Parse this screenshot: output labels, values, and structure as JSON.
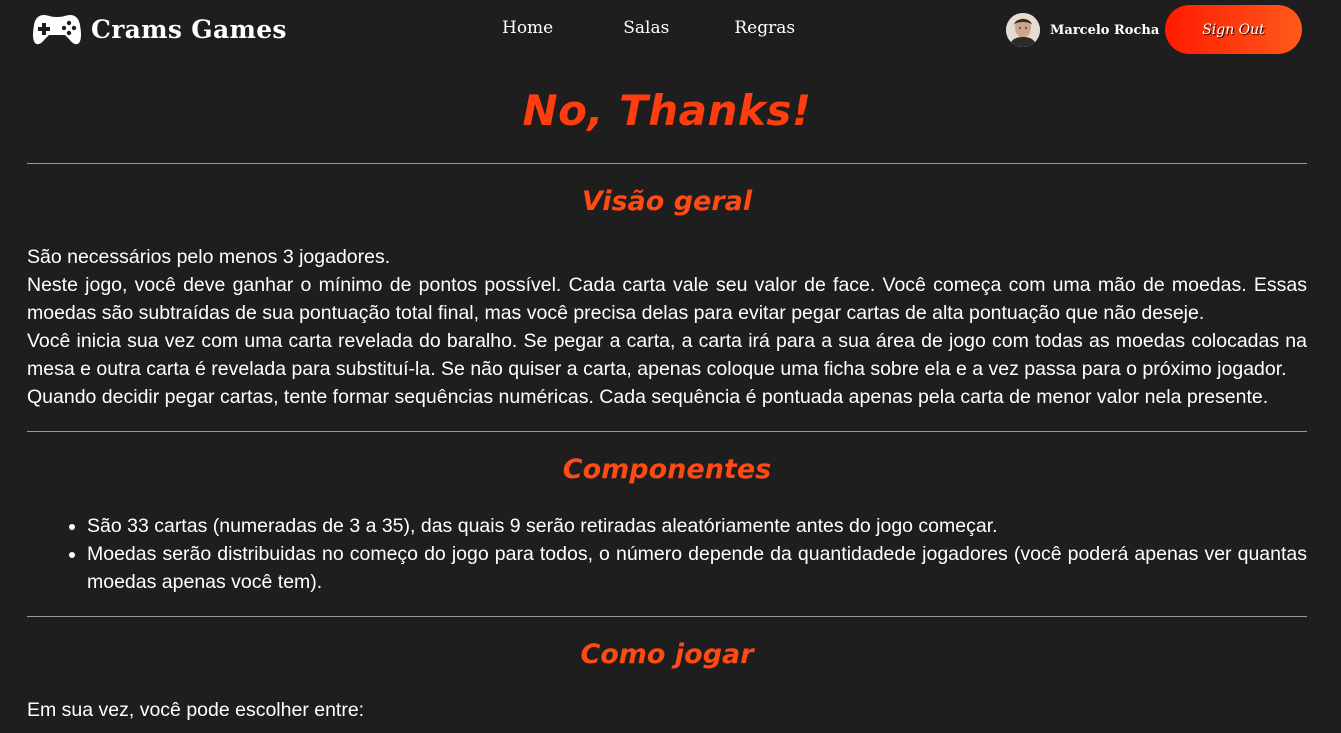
{
  "header": {
    "brand": "Crams Games",
    "brand_icon": "gamepad-icon",
    "nav": [
      "Home",
      "Salas",
      "Regras"
    ],
    "user_name": "Marcelo Rocha",
    "sign_out": "Sign Out"
  },
  "page": {
    "title": "No, Thanks!"
  },
  "sections": {
    "overview": {
      "title": "Visão geral",
      "lines": [
        "São necessários pelo menos 3 jogadores.",
        "Neste jogo, você deve ganhar o mínimo de pontos possível. Cada carta vale seu valor de face. Você começa com uma mão de moedas. Essas moedas são subtraídas de sua pontuação total final, mas você precisa delas para evitar pegar cartas de alta pontuação que não deseje.",
        "Você inicia sua vez com uma carta revelada do baralho. Se pegar a carta, a carta irá para a sua área de jogo com todas as moedas colocadas na mesa e outra carta é revelada para substituí-la. Se não quiser a carta, apenas coloque uma ficha sobre ela e a vez passa para o próximo jogador.",
        "Quando decidir pegar cartas, tente formar sequências numéricas. Cada sequência é pontuada apenas pela carta de menor valor nela presente."
      ]
    },
    "components": {
      "title": "Componentes",
      "items": [
        "São 33 cartas (numeradas de 3 a 35), das quais 9 serão retiradas aleatóriamente antes do jogo começar.",
        "Moedas serão distribuidas no começo do jogo para todos, o número depende da quantidadede jogadores (você poderá apenas ver quantas moedas apenas você tem)."
      ]
    },
    "how_to_play": {
      "title": "Como jogar",
      "intro": "Em sua vez, você pode escolher entre:"
    }
  },
  "colors": {
    "background": "#1e1e1e",
    "accent": "#ff3d0f",
    "button_gradient_start": "#ff1a00",
    "button_gradient_end": "#ff5a1c"
  }
}
